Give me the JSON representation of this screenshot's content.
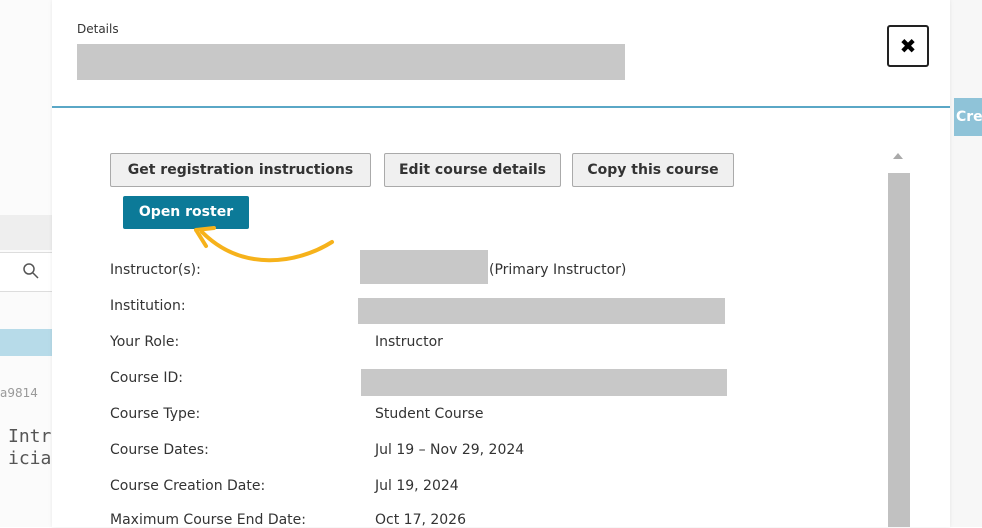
{
  "background": {
    "id_fragment": "a9814",
    "title_line1": "Intr",
    "title_line2": "icia",
    "right_button": "Cre"
  },
  "modal": {
    "details_label": "Details",
    "close_symbol": "✖"
  },
  "buttons": {
    "registration": "Get registration instructions",
    "edit": "Edit course details",
    "copy": "Copy this course",
    "roster": "Open roster"
  },
  "fields": {
    "instructor_label": "Instructor(s):",
    "instructor_suffix": "(Primary Instructor)",
    "institution_label": "Institution:",
    "role_label": "Your Role:",
    "role_value": "Instructor",
    "course_id_label": "Course ID:",
    "course_type_label": "Course Type:",
    "course_type_value": "Student Course",
    "course_dates_label": "Course Dates:",
    "course_dates_value": "Jul 19 – Nov 29, 2024",
    "creation_label": "Course Creation Date:",
    "creation_value": "Jul 19, 2024",
    "max_end_label": "Maximum Course End Date:",
    "max_end_value": "Oct 17, 2026"
  },
  "colors": {
    "primary": "#0c7a98",
    "annotation_arrow": "#f6b21b",
    "header_rule": "#5aa7c6"
  },
  "icons": [
    "search-icon",
    "close-icon",
    "scroll-up-icon",
    "arrow-annotation-icon"
  ]
}
